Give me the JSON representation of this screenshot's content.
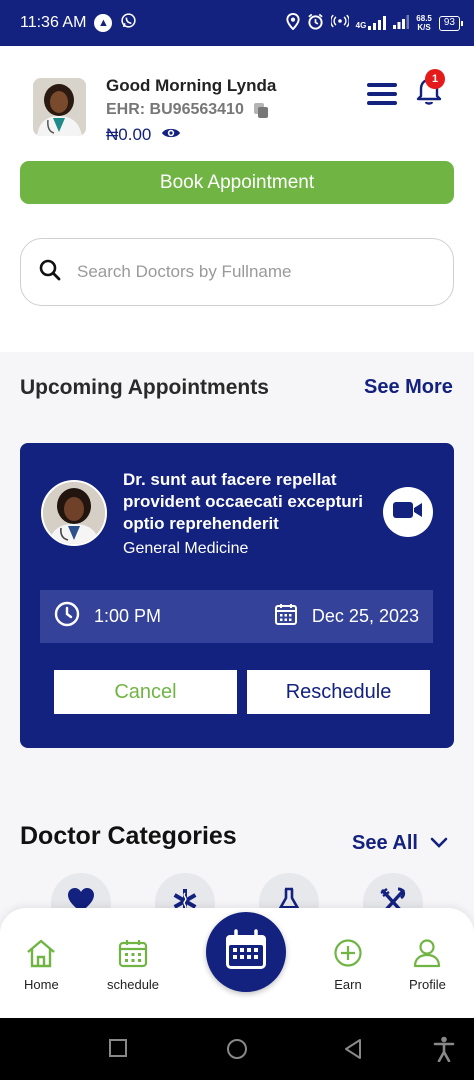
{
  "status_bar": {
    "time": "11:36 AM",
    "net_speed_value": "68.5",
    "net_speed_unit": "K/S",
    "network_type": "4G",
    "battery": "93"
  },
  "profile": {
    "greeting": "Good Morning Lynda",
    "ehr": "EHR: BU96563410",
    "balance": "₦0.00",
    "notification_count": "1"
  },
  "actions": {
    "book_appointment": "Book Appointment"
  },
  "search": {
    "placeholder": "Search Doctors by Fullname"
  },
  "upcoming": {
    "title": "Upcoming Appointments",
    "see_more": "See More",
    "appointment": {
      "doctor_name": "Dr. sunt aut facere repellat provident occaecati excepturi optio reprehenderit",
      "specialty": "General Medicine",
      "time": "1:00 PM",
      "date": "Dec 25, 2023",
      "cancel_label": "Cancel",
      "reschedule_label": "Reschedule"
    }
  },
  "categories": {
    "title": "Doctor Categories",
    "see_all": "See All",
    "items": [
      {
        "icon": "heart-icon"
      },
      {
        "icon": "medical-star-icon"
      },
      {
        "icon": "flask-icon"
      },
      {
        "icon": "fork-knife-icon"
      }
    ]
  },
  "bottom_nav": {
    "home": "Home",
    "schedule": "schedule",
    "earn": "Earn",
    "profile": "Profile"
  },
  "colors": {
    "primary": "#13217f",
    "accent_green": "#70b544",
    "badge_red": "#e51b1b"
  }
}
